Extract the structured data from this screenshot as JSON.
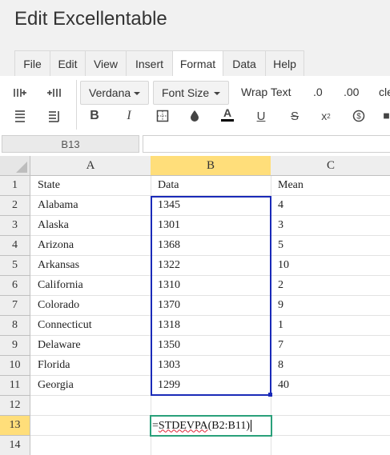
{
  "app": {
    "title": "Edit Excellentable"
  },
  "menu": {
    "tabs": [
      {
        "label": "File"
      },
      {
        "label": "Edit"
      },
      {
        "label": "View"
      },
      {
        "label": "Insert"
      },
      {
        "label": "Format",
        "active": true
      },
      {
        "label": "Data"
      },
      {
        "label": "Help"
      }
    ]
  },
  "toolbar": {
    "font_family": "Verdana",
    "font_size": "Font Size",
    "wrap_text": "Wrap Text",
    "decimal_decrease": ".0",
    "decimal_increase": ".00",
    "clear": "cle",
    "icons": [
      "insert-column-left-icon",
      "insert-column-right-icon",
      "insert-row-above-icon",
      "insert-row-below-icon",
      "bold-icon",
      "italic-icon",
      "borders-icon",
      "fill-color-icon",
      "text-color-icon",
      "underline-icon",
      "strikethrough-icon",
      "superscript-icon",
      "currency-icon",
      "more-icon"
    ],
    "text_color_accent": "#000000"
  },
  "formula_bar": {
    "cell_ref": "B13",
    "value": ""
  },
  "grid": {
    "columns": [
      "A",
      "B",
      "C"
    ],
    "selected_column": "B",
    "row_numbers": [
      "1",
      "2",
      "3",
      "4",
      "5",
      "6",
      "7",
      "8",
      "9",
      "10",
      "11",
      "12",
      "13",
      "14"
    ],
    "selected_row": "13",
    "rows": [
      [
        "State",
        "Data",
        "Mean"
      ],
      [
        "Alabama",
        "1345",
        "4"
      ],
      [
        "Alaska",
        "1301",
        "3"
      ],
      [
        "Arizona",
        "1368",
        "5"
      ],
      [
        "Arkansas",
        "1322",
        "10"
      ],
      [
        "California",
        "1310",
        "2"
      ],
      [
        "Colorado",
        "1370",
        "9"
      ],
      [
        "Connecticut",
        "1318",
        "1"
      ],
      [
        "Delaware",
        "1350",
        "7"
      ],
      [
        "Florida",
        "1303",
        "8"
      ],
      [
        "Georgia",
        "1299",
        "40"
      ],
      [
        "",
        "",
        ""
      ],
      [
        "",
        "",
        ""
      ],
      [
        "",
        "",
        ""
      ]
    ],
    "active_cell_formula": {
      "prefix": "=",
      "function": "STDEVPA",
      "args": "(B2:B11)"
    },
    "colors": {
      "selection_header": "#ffde7a",
      "range_border": "#1a2ab8",
      "edit_border": "#2aa07a"
    }
  }
}
